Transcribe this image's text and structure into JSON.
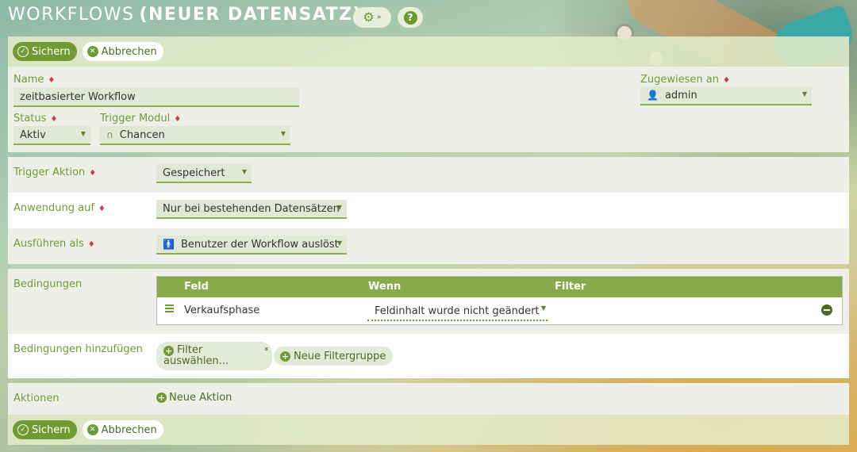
{
  "header": {
    "title": "WORKFLOWS",
    "subtitle": "(NEUER DATENSATZ)",
    "settings_icon": "gear-icon",
    "help_icon": "question-icon"
  },
  "toolbar": {
    "save_label": "Sichern",
    "cancel_label": "Abbrechen"
  },
  "form": {
    "name_label": "Name",
    "name_value": "zeitbasierter Workflow",
    "assigned_label": "Zugewiesen an",
    "assigned_value": "admin",
    "status_label": "Status",
    "status_value": "Aktiv",
    "trigger_module_label": "Trigger Modul",
    "trigger_module_value": "Chancen",
    "trigger_action_label": "Trigger Aktion",
    "trigger_action_value": "Gespeichert",
    "apply_on_label": "Anwendung auf",
    "apply_on_value": "Nur bei bestehenden Datensätzen",
    "run_as_label": "Ausführen als",
    "run_as_value": "Benutzer der Workflow auslöst"
  },
  "conditions": {
    "label": "Bedingungen",
    "columns": [
      "Feld",
      "Wenn",
      "Filter"
    ],
    "rows": [
      {
        "field": "Verkaufsphase",
        "when": "Feldinhalt wurde nicht geändert",
        "filter": ""
      }
    ]
  },
  "add_conditions": {
    "label": "Bedingungen hinzufügen",
    "select_filter_line1": "Filter",
    "select_filter_line2": "auswählen...",
    "new_filter_group": "Neue Filtergruppe"
  },
  "actions": {
    "label": "Aktionen",
    "new_action": "Neue Aktion"
  },
  "colors": {
    "accent": "#6f9c32",
    "required": "#d33b3b",
    "table_header": "#87aa4b"
  }
}
